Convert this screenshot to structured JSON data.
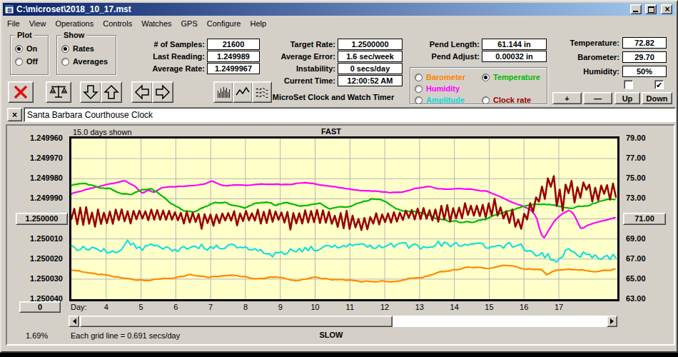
{
  "window": {
    "title": "C:\\microset\\2018_10_17.mst"
  },
  "menu": [
    "File",
    "View",
    "Operations",
    "Controls",
    "Watches",
    "GPS",
    "Configure",
    "Help"
  ],
  "plot_group": {
    "label": "Plot",
    "options": [
      {
        "label": "On",
        "selected": true
      },
      {
        "label": "Off",
        "selected": false
      }
    ]
  },
  "show_group": {
    "label": "Show",
    "options": [
      {
        "label": "Rates",
        "selected": true
      },
      {
        "label": "Averages",
        "selected": false
      }
    ]
  },
  "fields_samples": [
    {
      "label": "# of Samples:",
      "value": "21600"
    },
    {
      "label": "Last Reading:",
      "value": "1.249989"
    },
    {
      "label": "Average Rate:",
      "value": "1.2499967"
    }
  ],
  "fields_rate": [
    {
      "label": "Target Rate:",
      "value": "1.2500000"
    },
    {
      "label": "Average Error:",
      "value": "1.6 sec/week"
    },
    {
      "label": "Instability:",
      "value": "0 secs/day"
    },
    {
      "label": "Current Time:",
      "value": "12:00:52 AM"
    }
  ],
  "fields_pend": [
    {
      "label": "Pend Length:",
      "value": "61.144 in"
    },
    {
      "label": "Pend Adjust:",
      "value": "0.00032 in"
    }
  ],
  "fields_env": [
    {
      "label": "Temperature:",
      "value": "72.82"
    },
    {
      "label": "Barometer:",
      "value": "29.70"
    },
    {
      "label": "Humidity:",
      "value": "50%"
    }
  ],
  "app_caption": "MicroSet Clock and Watch Timer",
  "sensor_group": {
    "options": [
      {
        "label": "Barometer",
        "color": "#ff8000",
        "selected": false,
        "col": 0,
        "row": 0
      },
      {
        "label": "Humidity",
        "color": "#ff00ff",
        "selected": false,
        "col": 0,
        "row": 1
      },
      {
        "label": "Amplitude",
        "color": "#00dddd",
        "selected": false,
        "col": 0,
        "row": 2
      },
      {
        "label": "Temperature",
        "color": "#00bb00",
        "selected": true,
        "col": 1,
        "row": 0
      },
      {
        "label": "Clock rate",
        "color": "#990000",
        "selected": false,
        "col": 1,
        "row": 2
      }
    ]
  },
  "checkboxes": [
    {
      "checked": false
    },
    {
      "checked": true
    }
  ],
  "buttons": {
    "plus": "+",
    "minus": "—",
    "up": "Up",
    "down": "Down"
  },
  "clock_name": "Santa Barbara Courthouse Clock",
  "chart_data": {
    "type": "line",
    "top_label": "FAST",
    "bottom_label": "SLOW",
    "days_shown_label": "15.0 days shown",
    "grid_note": "Each grid line = 0.691 secs/day",
    "percent_label": "1.69%",
    "day_axis_label": "Day:",
    "day_ticks": [
      4,
      5,
      6,
      7,
      8,
      9,
      10,
      11,
      12,
      13,
      14,
      15,
      16,
      17
    ],
    "x_range": [
      3.0,
      18.68
    ],
    "left_axis": {
      "labels": [
        "1.249960",
        "1.249970",
        "1.249980",
        "1.249990",
        "1.250000",
        "1.250010",
        "1.250020",
        "1.250030",
        "1.250040"
      ],
      "button_index": 4
    },
    "right_axis": {
      "labels": [
        "79.00",
        "77.00",
        "75.00",
        "73.00",
        "71.00",
        "69.00",
        "67.00",
        "65.00",
        "63.00"
      ],
      "button_index": 4,
      "range": [
        79,
        63
      ]
    },
    "zero_button": "0",
    "series": [
      {
        "name": "Barometer",
        "color": "#ff8a00",
        "width": 2.2,
        "noise": 0.15,
        "smooth": 8,
        "factor": 2.0,
        "step": 0.07,
        "zigzag": false,
        "keypoints": [
          [
            3,
            65.7
          ],
          [
            3.6,
            65.6
          ],
          [
            4.2,
            65.3
          ],
          [
            4.8,
            65.0
          ],
          [
            5.3,
            64.8
          ],
          [
            5.9,
            65.2
          ],
          [
            6.4,
            65.4
          ],
          [
            7.0,
            65.2
          ],
          [
            7.6,
            65.4
          ],
          [
            8.2,
            65.1
          ],
          [
            8.8,
            65.2
          ],
          [
            9.4,
            65.0
          ],
          [
            10.0,
            65.1
          ],
          [
            10.6,
            64.9
          ],
          [
            11.2,
            64.8
          ],
          [
            11.8,
            64.7
          ],
          [
            12.4,
            64.8
          ],
          [
            13.0,
            65.2
          ],
          [
            13.6,
            65.7
          ],
          [
            14.2,
            66.0
          ],
          [
            14.8,
            66.2
          ],
          [
            15.4,
            66.3
          ],
          [
            16.0,
            66.1
          ],
          [
            16.5,
            66.0
          ],
          [
            16.65,
            65.5
          ],
          [
            16.9,
            66.0
          ],
          [
            17.3,
            66.0
          ],
          [
            17.7,
            65.8
          ],
          [
            18.0,
            65.7
          ],
          [
            18.3,
            66.0
          ],
          [
            18.65,
            66.1
          ]
        ]
      },
      {
        "name": "Amplitude",
        "color": "#00e0e0",
        "width": 2,
        "noise": 0.3,
        "smooth": 1,
        "factor": 1.0,
        "step": 0.085,
        "zigzag": false,
        "keypoints": [
          [
            3,
            68.1
          ],
          [
            3.5,
            68.0
          ],
          [
            4.2,
            67.6
          ],
          [
            4.6,
            68.6
          ],
          [
            5.0,
            68.0
          ],
          [
            5.4,
            68.4
          ],
          [
            6.0,
            68.0
          ],
          [
            6.5,
            68.3
          ],
          [
            7.0,
            68.1
          ],
          [
            7.6,
            68.4
          ],
          [
            8.2,
            67.9
          ],
          [
            8.8,
            67.4
          ],
          [
            9.3,
            67.9
          ],
          [
            10.0,
            68.0
          ],
          [
            10.5,
            68.3
          ],
          [
            11.2,
            68.6
          ],
          [
            11.8,
            68.3
          ],
          [
            12.5,
            68.4
          ],
          [
            13.0,
            68.2
          ],
          [
            13.6,
            68.5
          ],
          [
            14.2,
            68.3
          ],
          [
            14.8,
            68.4
          ],
          [
            15.3,
            68.2
          ],
          [
            15.8,
            68.5
          ],
          [
            16.3,
            67.5
          ],
          [
            16.7,
            67.3
          ],
          [
            17.0,
            66.9
          ],
          [
            17.2,
            68.0
          ],
          [
            17.5,
            67.3
          ],
          [
            17.8,
            67.5
          ],
          [
            18.1,
            67.1
          ],
          [
            18.4,
            67.3
          ],
          [
            18.65,
            67.1
          ]
        ]
      },
      {
        "name": "Humidity",
        "color": "#ff00ff",
        "width": 2.2,
        "noise": 0.12,
        "smooth": 10,
        "factor": 2.2,
        "step": 0.07,
        "zigzag": false,
        "keypoints": [
          [
            3,
            73.5
          ],
          [
            3.4,
            73.9
          ],
          [
            3.8,
            74.2
          ],
          [
            4.3,
            74.5
          ],
          [
            4.55,
            74.7
          ],
          [
            4.8,
            74.3
          ],
          [
            5.05,
            73.5
          ],
          [
            5.2,
            73.9
          ],
          [
            5.35,
            73.5
          ],
          [
            5.6,
            74.0
          ],
          [
            6.0,
            74.2
          ],
          [
            6.4,
            74.3
          ],
          [
            6.8,
            74.4
          ],
          [
            7.05,
            74.8
          ],
          [
            7.3,
            74.4
          ],
          [
            7.7,
            74.4
          ],
          [
            8.1,
            74.3
          ],
          [
            8.5,
            74.5
          ],
          [
            8.9,
            74.5
          ],
          [
            9.3,
            74.4
          ],
          [
            9.7,
            74.5
          ],
          [
            10.1,
            74.4
          ],
          [
            10.5,
            74.3
          ],
          [
            10.9,
            74.0
          ],
          [
            11.3,
            73.8
          ],
          [
            11.7,
            73.7
          ],
          [
            12.1,
            73.6
          ],
          [
            12.5,
            73.7
          ],
          [
            12.9,
            74.0
          ],
          [
            13.3,
            74.2
          ],
          [
            13.7,
            74.0
          ],
          [
            14.1,
            73.9
          ],
          [
            14.5,
            73.9
          ],
          [
            14.9,
            73.7
          ],
          [
            15.3,
            73.2
          ],
          [
            15.7,
            72.6
          ],
          [
            16.0,
            72.2
          ],
          [
            16.2,
            71.9
          ],
          [
            16.35,
            71.3
          ],
          [
            16.45,
            70.0
          ],
          [
            16.55,
            69.0
          ],
          [
            16.7,
            69.9
          ],
          [
            16.9,
            70.9
          ],
          [
            17.1,
            71.5
          ],
          [
            17.3,
            71.8
          ],
          [
            17.45,
            71.3
          ],
          [
            17.55,
            70.5
          ],
          [
            17.65,
            69.9
          ],
          [
            17.8,
            70.3
          ],
          [
            18.0,
            70.6
          ],
          [
            18.3,
            70.9
          ],
          [
            18.65,
            71.1
          ]
        ]
      },
      {
        "name": "Temperature",
        "color": "#00bb00",
        "width": 2.2,
        "noise": 0.22,
        "smooth": 8,
        "factor": 2.2,
        "step": 0.07,
        "zigzag": false,
        "keypoints": [
          [
            3,
            74.4
          ],
          [
            3.4,
            74.3
          ],
          [
            3.8,
            73.9
          ],
          [
            4.1,
            74.0
          ],
          [
            4.4,
            73.5
          ],
          [
            4.7,
            73.4
          ],
          [
            5.0,
            73.9
          ],
          [
            5.3,
            73.9
          ],
          [
            5.6,
            73.3
          ],
          [
            5.9,
            72.5
          ],
          [
            6.2,
            71.9
          ],
          [
            6.5,
            71.7
          ],
          [
            6.8,
            72.0
          ],
          [
            7.1,
            72.6
          ],
          [
            7.4,
            72.8
          ],
          [
            7.7,
            72.4
          ],
          [
            8.0,
            71.9
          ],
          [
            8.3,
            72.5
          ],
          [
            8.6,
            72.8
          ],
          [
            8.9,
            72.4
          ],
          [
            9.2,
            72.7
          ],
          [
            9.5,
            72.5
          ],
          [
            9.8,
            72.3
          ],
          [
            10.1,
            72.5
          ],
          [
            10.4,
            72.2
          ],
          [
            10.7,
            72.4
          ],
          [
            11.0,
            72.1
          ],
          [
            11.3,
            72.7
          ],
          [
            11.6,
            73.1
          ],
          [
            11.9,
            72.8
          ],
          [
            12.2,
            72.3
          ],
          [
            12.5,
            71.9
          ],
          [
            12.9,
            71.5
          ],
          [
            13.3,
            71.2
          ],
          [
            13.7,
            70.9
          ],
          [
            14.1,
            70.7
          ],
          [
            14.5,
            70.6
          ],
          [
            14.9,
            71.0
          ],
          [
            15.3,
            71.4
          ],
          [
            15.7,
            71.9
          ],
          [
            16.0,
            72.2
          ],
          [
            16.3,
            72.5
          ],
          [
            16.6,
            72.6
          ],
          [
            16.9,
            72.5
          ],
          [
            17.2,
            72.0
          ],
          [
            17.4,
            71.8
          ],
          [
            17.6,
            72.1
          ],
          [
            17.9,
            72.4
          ],
          [
            18.2,
            72.8
          ],
          [
            18.45,
            73.0
          ],
          [
            18.65,
            72.9
          ]
        ]
      },
      {
        "name": "Clock rate",
        "color": "#990000",
        "width": 2.6,
        "noise": 0.5,
        "smooth": 1,
        "factor": 1.0,
        "step": 0.085,
        "zigzag": true,
        "keypoints": [
          [
            3,
            71.3
          ],
          [
            4,
            71.2
          ],
          [
            5,
            71.4
          ],
          [
            6,
            71.2
          ],
          [
            7,
            71.0
          ],
          [
            7.5,
            71.3
          ],
          [
            8,
            71.2
          ],
          [
            9,
            71.3
          ],
          [
            9.5,
            71.0
          ],
          [
            10,
            71.2
          ],
          [
            10.8,
            70.8
          ],
          [
            11.3,
            70.4
          ],
          [
            11.8,
            71.0
          ],
          [
            12.3,
            71.2
          ],
          [
            12.8,
            71.5
          ],
          [
            13.3,
            71.4
          ],
          [
            13.8,
            71.6
          ],
          [
            14.3,
            71.8
          ],
          [
            14.8,
            71.7
          ],
          [
            15.2,
            72.0
          ],
          [
            15.6,
            71.0
          ],
          [
            15.9,
            70.3
          ],
          [
            16.1,
            71.5
          ],
          [
            16.4,
            73.0
          ],
          [
            16.6,
            73.8
          ],
          [
            16.8,
            75.2
          ],
          [
            16.95,
            73.5
          ],
          [
            17.1,
            72.6
          ],
          [
            17.3,
            74.6
          ],
          [
            17.45,
            73.3
          ],
          [
            17.6,
            73.6
          ],
          [
            17.8,
            74.3
          ],
          [
            17.95,
            73.2
          ],
          [
            18.1,
            73.4
          ],
          [
            18.3,
            73.9
          ],
          [
            18.5,
            73.5
          ],
          [
            18.65,
            74.0
          ]
        ]
      }
    ]
  }
}
